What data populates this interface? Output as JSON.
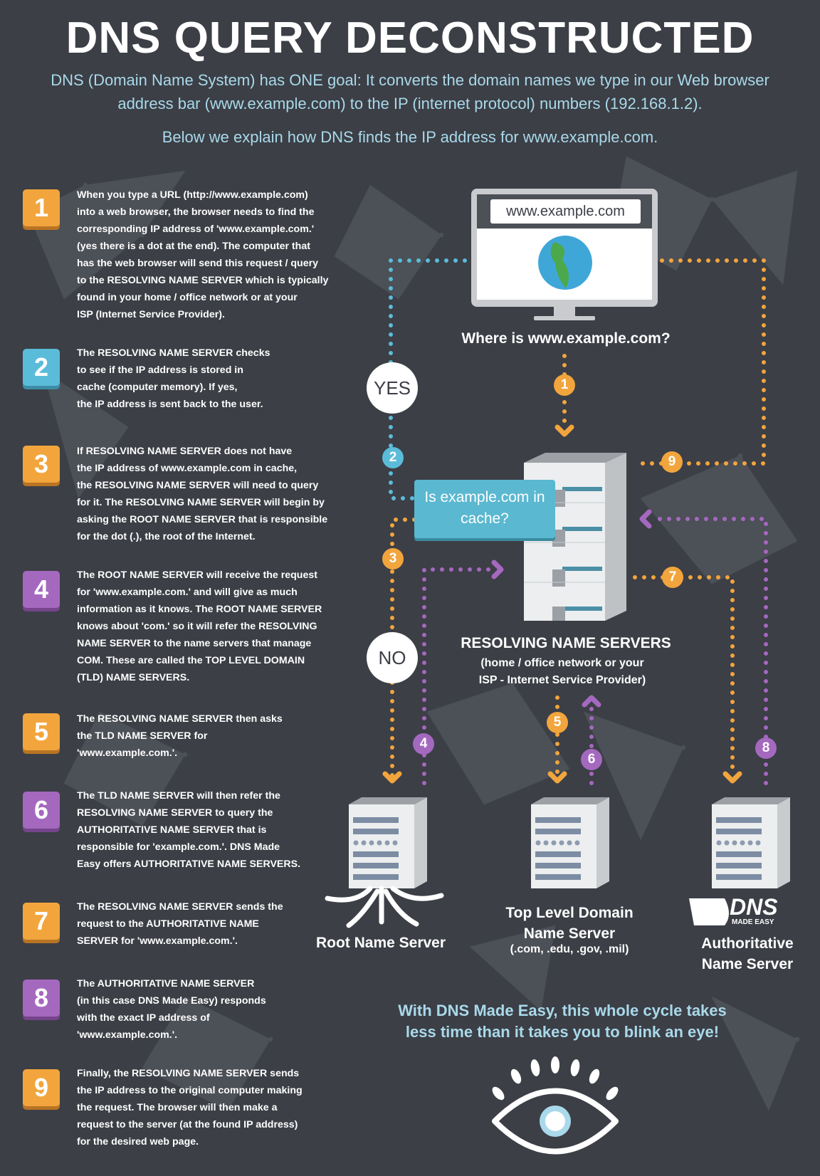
{
  "header": {
    "title": "DNS QUERY DECONSTRUCTED",
    "subtitle": "DNS (Domain Name System) has ONE goal:  It converts the domain names we type in our Web browser address bar (www.example.com) to the IP (internet protocol) numbers (192.168.1.2).",
    "intro": "Below we explain how DNS finds the IP address for www.example.com."
  },
  "colors": {
    "background": "#3c3f46",
    "orange": "#f2a53d",
    "blue": "#5bbcd9",
    "purple": "#a568bf",
    "accent_text": "#a9d9ea"
  },
  "steps": [
    {
      "number": "1",
      "color": "orange",
      "text": "When you type a URL (http://www.example.com)\ninto a web browser, the browser needs to find the\ncorresponding IP address of  'www.example.com.'\n(yes there is a dot at the end). The computer that\nhas the web browser will send this request / query\nto the RESOLVING NAME SERVER which is typically\nfound in your home / office network or at your\nISP (Internet Service Provider)."
    },
    {
      "number": "2",
      "color": "blue",
      "text": "The RESOLVING NAME SERVER checks\nto see if the IP address is stored in\ncache (computer memory).  If yes,\nthe IP address is sent back to the user."
    },
    {
      "number": "3",
      "color": "orange",
      "text": "If RESOLVING NAME SERVER does not have\nthe IP address of www.example.com in cache,\nthe RESOLVING NAME SERVER will need to query\nfor it.  The RESOLVING NAME SERVER will begin by\nasking the ROOT NAME SERVER that is responsible\nfor the dot (.), the root of the Internet."
    },
    {
      "number": "4",
      "color": "purple",
      "text": "The ROOT NAME SERVER will receive the request\nfor 'www.example.com.' and will give as much\ninformation as it knows.  The ROOT NAME SERVER\nknows about 'com.' so it will refer the RESOLVING\nNAME SERVER to the name servers that manage\nCOM. These are called the TOP LEVEL DOMAIN\n(TLD) NAME SERVERS."
    },
    {
      "number": "5",
      "color": "orange",
      "text": "The RESOLVING NAME SERVER then asks\nthe TLD NAME SERVER for\n'www.example.com.'."
    },
    {
      "number": "6",
      "color": "purple",
      "text": "The TLD NAME SERVER will then refer the\nRESOLVING NAME SERVER to query the\nAUTHORITATIVE NAME SERVER that is\nresponsible for 'example.com.'. DNS Made\nEasy offers AUTHORITATIVE NAME SERVERS."
    },
    {
      "number": "7",
      "color": "orange",
      "text": "The RESOLVING NAME SERVER sends the\nrequest to the AUTHORITATIVE NAME\nSERVER for 'www.example.com.'."
    },
    {
      "number": "8",
      "color": "purple",
      "text": "The AUTHORITATIVE NAME SERVER\n(in this case DNS Made Easy) responds\nwith the exact IP address of\n'www.example.com.'."
    },
    {
      "number": "9",
      "color": "orange",
      "text": "Finally, the RESOLVING NAME SERVER sends\nthe IP address to the original computer making\nthe request.  The browser will then make a\nrequest to the server (at the found IP address)\nfor the desired web page."
    }
  ],
  "diagram": {
    "url_bar": "www.example.com",
    "question": "Where is www.example.com?",
    "yes_label": "YES",
    "no_label": "NO",
    "cache_callout": "Is example.com in cache?",
    "resolving_title": "RESOLVING NAME SERVERS",
    "resolving_sub": "(home / office network or your ISP - Internet Service Provider)",
    "root_label": "Root Name Server",
    "tld_label": "Top Level Domain Name Server",
    "tld_sub": "(.com, .edu, .gov, .mil)",
    "auth_label": "Authoritative Name Server",
    "logo_main": "DNS",
    "logo_sub": "MADE EASY",
    "markers": [
      "1",
      "2",
      "3",
      "4",
      "5",
      "6",
      "7",
      "8",
      "9"
    ]
  },
  "footer": {
    "line1": "With DNS Made Easy, this whole cycle takes",
    "line2": "less time than it takes you to blink an eye!"
  }
}
